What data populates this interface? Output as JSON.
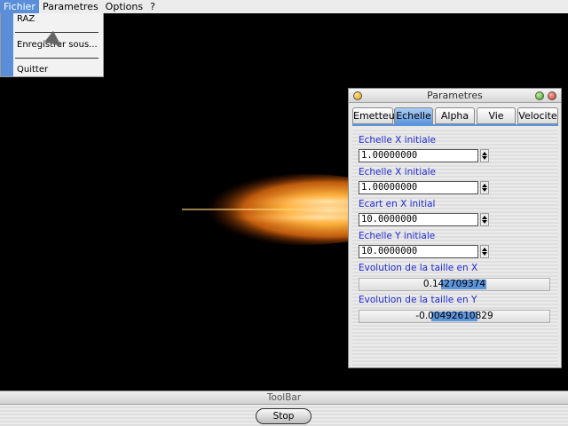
{
  "menubar": {
    "items": [
      {
        "label": "Fichier",
        "active": true
      },
      {
        "label": "Parametres",
        "active": false
      },
      {
        "label": "Options",
        "active": false
      },
      {
        "label": "?",
        "active": false
      }
    ]
  },
  "file_menu": {
    "items": [
      "RAZ",
      "Enregistrer sous...",
      "Quitter"
    ]
  },
  "param_window": {
    "title": "Parametres",
    "tabs": [
      {
        "label": "Emetteur",
        "active": false
      },
      {
        "label": "Echelle",
        "active": true
      },
      {
        "label": "Alpha",
        "active": false
      },
      {
        "label": "Vie",
        "active": false
      },
      {
        "label": "Velocite",
        "active": false
      }
    ],
    "fields": [
      {
        "label": "Echelle X initiale",
        "value": "1.00000000"
      },
      {
        "label": "Echelle X initiale",
        "value": "1.00000000"
      },
      {
        "label": "Ecart en X initial",
        "value": "10.0000000"
      },
      {
        "label": "Echelle Y initiale",
        "value": "10.0000000"
      }
    ],
    "sliders": [
      {
        "label": "Evolution de la taille en X",
        "value": "0.142709374",
        "fill_start": 0.43,
        "fill_end": 0.67
      },
      {
        "label": "Evolution de la taille en Y",
        "value": "-0.00492610829",
        "fill_start": 0.38,
        "fill_end": 0.62
      }
    ],
    "colors": {
      "accent": "#5d95da",
      "label": "#1e2ad8"
    }
  },
  "toolbar": {
    "title": "ToolBar",
    "stop_label": "Stop"
  }
}
